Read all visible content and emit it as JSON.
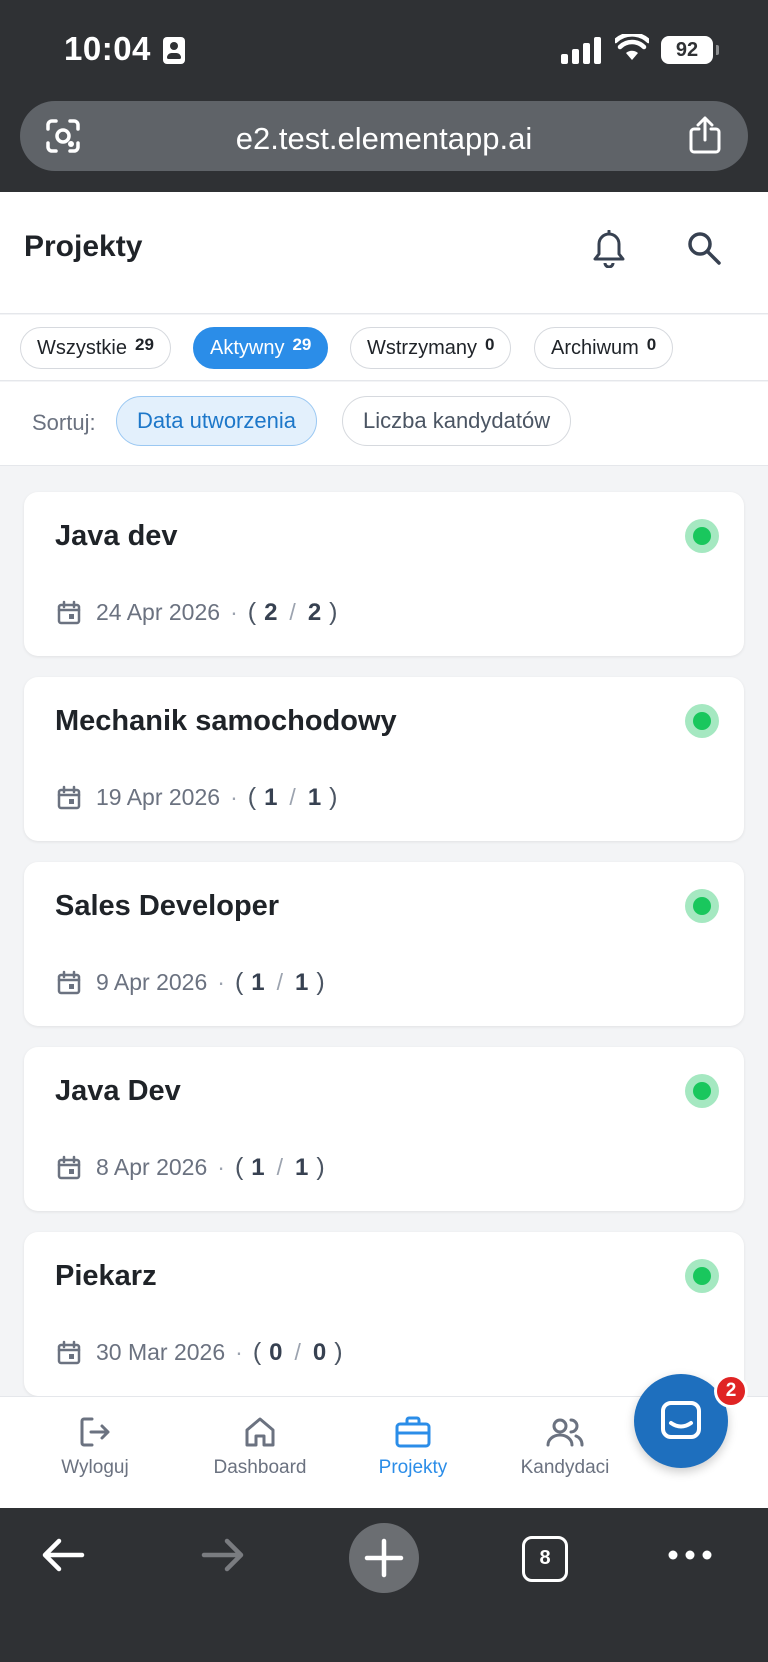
{
  "status_bar": {
    "time": "10:04",
    "battery": "92"
  },
  "browser": {
    "url": "e2.test.elementapp.ai",
    "tabs_count": "8"
  },
  "header": {
    "title": "Projekty"
  },
  "filters": [
    {
      "label": "Wszystkie",
      "count": "29",
      "active": false
    },
    {
      "label": "Aktywny",
      "count": "29",
      "active": true
    },
    {
      "label": "Wstrzymany",
      "count": "0",
      "active": false
    },
    {
      "label": "Archiwum",
      "count": "0",
      "active": false
    }
  ],
  "sort": {
    "label": "Sortuj:",
    "options": [
      {
        "label": "Data utworzenia",
        "active": true
      },
      {
        "label": "Liczba kandydatów",
        "active": false
      }
    ]
  },
  "projects": [
    {
      "title": "Java dev",
      "date": "24 Apr 2026",
      "current": "2",
      "total": "2",
      "status": "active"
    },
    {
      "title": "Mechanik samochodowy",
      "date": "19 Apr 2026",
      "current": "1",
      "total": "1",
      "status": "active"
    },
    {
      "title": "Sales Developer",
      "date": "9 Apr 2026",
      "current": "1",
      "total": "1",
      "status": "active"
    },
    {
      "title": "Java Dev",
      "date": "8 Apr 2026",
      "current": "1",
      "total": "1",
      "status": "active"
    },
    {
      "title": "Piekarz",
      "date": "30 Mar 2026",
      "current": "0",
      "total": "0",
      "status": "active"
    }
  ],
  "bottom_nav": [
    {
      "label": "Wyloguj",
      "icon": "logout-icon",
      "active": false
    },
    {
      "label": "Dashboard",
      "icon": "home-icon",
      "active": false
    },
    {
      "label": "Projekty",
      "icon": "briefcase-icon",
      "active": true
    },
    {
      "label": "Kandydaci",
      "icon": "users-icon",
      "active": false
    }
  ],
  "chat": {
    "badge": "2"
  },
  "colors": {
    "accent": "#2b8de8",
    "active_status": "#19c75d",
    "chat": "#1e6fbe",
    "badge": "#e02424"
  }
}
